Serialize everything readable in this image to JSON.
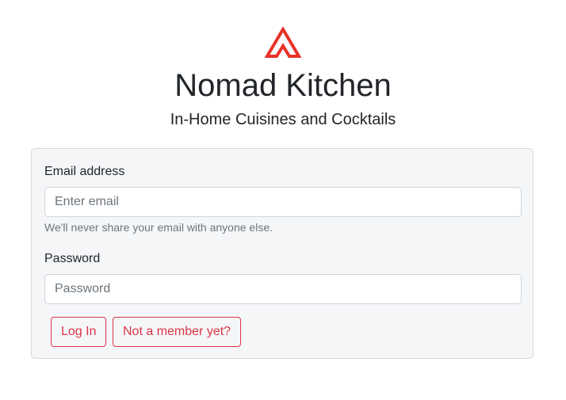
{
  "brand": {
    "title": "Nomad Kitchen",
    "subtitle": "In-Home Cuisines and Cocktails",
    "logo_icon": "nomad-tent-logo-icon",
    "logo_color": "#e8322a"
  },
  "login_form": {
    "email": {
      "label": "Email address",
      "placeholder": "Enter email",
      "value": "",
      "help_text": "We'll never share your email with anyone else."
    },
    "password": {
      "label": "Password",
      "placeholder": "Password",
      "value": ""
    },
    "buttons": {
      "login_label": "Log In",
      "signup_label": "Not a member yet?"
    },
    "accent_color": "#dc3545"
  }
}
